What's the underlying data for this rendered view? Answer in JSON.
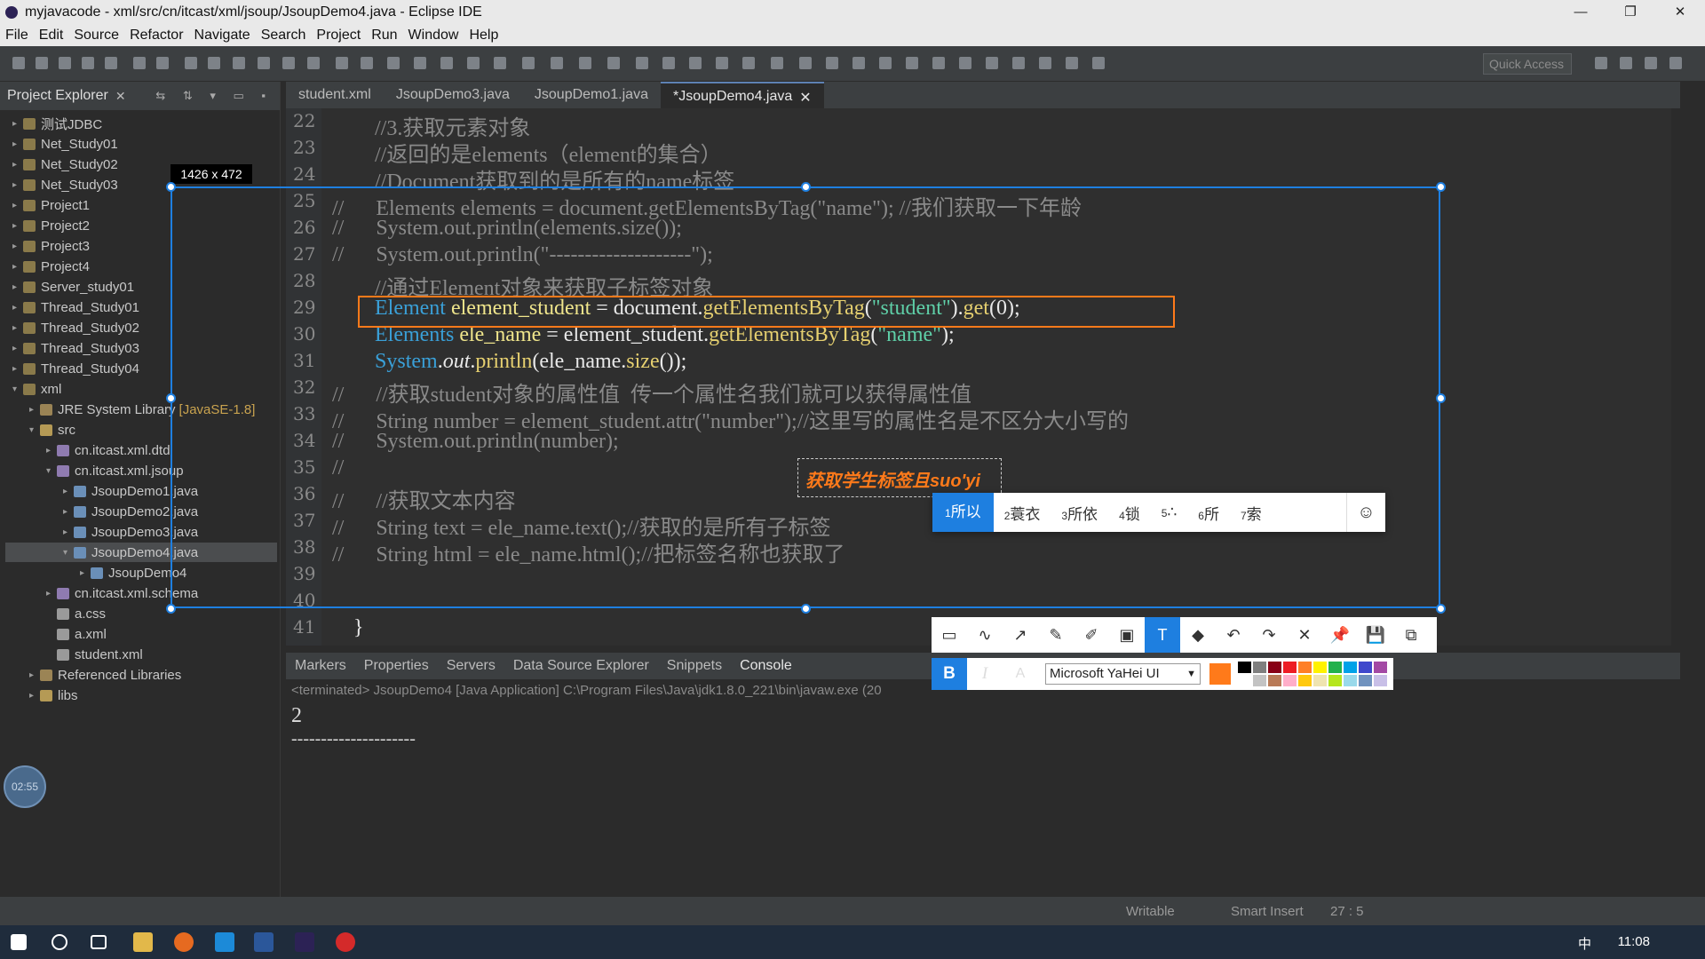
{
  "window": {
    "title": "myjavacode - xml/src/cn/itcast/xml/jsoup/JsoupDemo4.java - Eclipse IDE",
    "controls": [
      "—",
      "❐",
      "✕"
    ]
  },
  "menu": [
    "File",
    "Edit",
    "Source",
    "Refactor",
    "Navigate",
    "Search",
    "Project",
    "Run",
    "Window",
    "Help"
  ],
  "toolbar": {
    "quick_access": "Quick Access"
  },
  "explorer": {
    "title": "Project Explorer",
    "items": [
      {
        "label": "测试JDBC",
        "type": "project"
      },
      {
        "label": "Net_Study01",
        "type": "project"
      },
      {
        "label": "Net_Study02",
        "type": "project"
      },
      {
        "label": "Net_Study03",
        "type": "project"
      },
      {
        "label": "Project1",
        "type": "project"
      },
      {
        "label": "Project2",
        "type": "project"
      },
      {
        "label": "Project3",
        "type": "project"
      },
      {
        "label": "Project4",
        "type": "project"
      },
      {
        "label": "Server_study01",
        "type": "project"
      },
      {
        "label": "Thread_Study01",
        "type": "project"
      },
      {
        "label": "Thread_Study02",
        "type": "project"
      },
      {
        "label": "Thread_Study03",
        "type": "project"
      },
      {
        "label": "Thread_Study04",
        "type": "project"
      },
      {
        "label": "xml",
        "type": "project"
      },
      {
        "label": "JRE System Library",
        "type": "lib",
        "extra": "[JavaSE-1.8]"
      },
      {
        "label": "src",
        "type": "folder"
      },
      {
        "label": "cn.itcast.xml.dtd",
        "type": "pkg"
      },
      {
        "label": "cn.itcast.xml.jsoup",
        "type": "pkg"
      },
      {
        "label": "JsoupDemo1.java",
        "type": "java"
      },
      {
        "label": "JsoupDemo2.java",
        "type": "java"
      },
      {
        "label": "JsoupDemo3.java",
        "type": "java"
      },
      {
        "label": "JsoupDemo4.java",
        "type": "java"
      },
      {
        "label": "JsoupDemo4",
        "type": "java"
      },
      {
        "label": "cn.itcast.xml.schema",
        "type": "pkg"
      },
      {
        "label": "a.css",
        "type": "file"
      },
      {
        "label": "a.xml",
        "type": "file"
      },
      {
        "label": "student.xml",
        "type": "file"
      },
      {
        "label": "Referenced Libraries",
        "type": "lib"
      },
      {
        "label": "libs",
        "type": "folder"
      }
    ]
  },
  "editor": {
    "tabs": [
      "student.xml",
      "JsoupDemo3.java",
      "JsoupDemo1.java",
      "*JsoupDemo4.java"
    ],
    "active_tab": "*JsoupDemo4.java",
    "lines": [
      {
        "n": "22",
        "text": "        //3.获取元素对象"
      },
      {
        "n": "23",
        "text": "        //返回的是elements（element的集合）"
      },
      {
        "n": "24",
        "text": "        //Document获取到的是所有的name标签"
      },
      {
        "n": "25",
        "text": "//      Elements elements = document.getElementsByTag(\"name\"); //我们获取一下年龄"
      },
      {
        "n": "26",
        "text": "//      System.out.println(elements.size());"
      },
      {
        "n": "27",
        "text": "//      System.out.println(\"--------------------\");"
      },
      {
        "n": "28",
        "text": "        //通过Element对象来获取子标签对象"
      },
      {
        "n": "29",
        "text": "        Element element_student = document.getElementsByTag(\"student\").get(0);"
      },
      {
        "n": "30",
        "text": "        Elements ele_name = element_student.getElementsByTag(\"name\");"
      },
      {
        "n": "31",
        "text": "        System.out.println(ele_name.size());"
      },
      {
        "n": "32",
        "text": "//      //获取student对象的属性值  传一个属性名我们就可以获得属性值"
      },
      {
        "n": "33",
        "text": "//      String number = element_student.attr(\"number\");//这里写的属性名是不区分大小写的"
      },
      {
        "n": "34",
        "text": "//      System.out.println(number);"
      },
      {
        "n": "35",
        "text": "//"
      },
      {
        "n": "36",
        "text": "//      //获取文本内容"
      },
      {
        "n": "37",
        "text": "//      String text = ele_name.text();//获取的是所有子标签"
      },
      {
        "n": "38",
        "text": "//      String html = ele_name.html();//把标签名称也获取了"
      },
      {
        "n": "39",
        "text": ""
      },
      {
        "n": "40",
        "text": ""
      },
      {
        "n": "41",
        "text": "    }"
      }
    ]
  },
  "capture": {
    "size_label": "1426 x 472",
    "annotation_text": "获取学生标签且suo'yi",
    "ime_candidates": [
      "所以",
      "蓑衣",
      "所依",
      "锁",
      "∴",
      "所",
      "索"
    ],
    "ime_emoji": "☺",
    "font_name": "Microsoft YaHei UI",
    "current_color": "#ff7a1a",
    "tools": [
      "rect",
      "pencil-line",
      "arrow",
      "pen",
      "marker",
      "mosaic",
      "text",
      "eraser",
      "undo",
      "redo",
      "close",
      "pin",
      "save",
      "copy"
    ],
    "tool_glyphs": [
      "▭",
      "∿",
      "↗",
      "✎",
      "✐",
      "▣",
      "T",
      "◆",
      "↶",
      "↷",
      "✕",
      "📌",
      "💾",
      "⧉"
    ],
    "palette": [
      "#000000",
      "#7f7f7f",
      "#880015",
      "#ed1c24",
      "#ff7f27",
      "#fff200",
      "#22b14c",
      "#00a2e8",
      "#3f48cc",
      "#a349a4",
      "#ffffff",
      "#c3c3c3",
      "#b97a57",
      "#ffaec9",
      "#ffc90e",
      "#efe4b0",
      "#b5e61d",
      "#99d9ea",
      "#7092be",
      "#c8bfe7"
    ]
  },
  "bottom_panel": {
    "tabs": [
      "Markers",
      "Properties",
      "Servers",
      "Data Source Explorer",
      "Snippets",
      "Console"
    ],
    "active_tab": "Console",
    "terminated_line": "<terminated> JsoupDemo4 [Java Application] C:\\Program Files\\Java\\jdk1.8.0_221\\bin\\javaw.exe (20",
    "output": [
      "2",
      "---------------------"
    ]
  },
  "status": {
    "writable": "Writable",
    "insert": "Smart Insert",
    "position": "27 : 5"
  },
  "taskbar": {
    "time": "11:08",
    "ime": "中"
  },
  "recorder": {
    "time": "02:55"
  }
}
